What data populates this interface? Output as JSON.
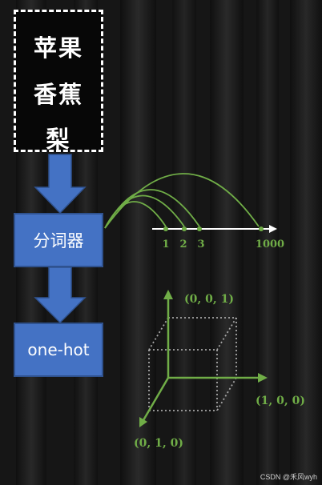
{
  "words": [
    "苹果",
    "香蕉",
    "梨"
  ],
  "boxes": {
    "tokenizer": "分词器",
    "onehot": "one-hot"
  },
  "number_line": {
    "labels": [
      "1",
      "2",
      "3",
      "1000"
    ]
  },
  "coordinates": {
    "z_axis": "(0, 0, 1)",
    "x_axis": "(1, 0, 0)",
    "y_axis": "(0, 1, 0)"
  },
  "watermark": "CSDN @禾风wyh",
  "colors": {
    "box_fill": "#4472c4",
    "accent_green": "#70ad47",
    "background": "#1a1a1a",
    "text": "#ffffff"
  }
}
